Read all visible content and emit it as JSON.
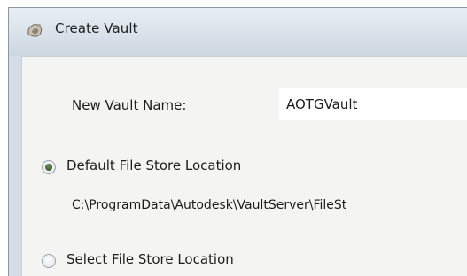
{
  "window": {
    "title": "Create Vault",
    "icon": "vault-app-icon"
  },
  "form": {
    "vault_name_label": "New Vault Name:",
    "vault_name_value": "AOTGVault",
    "file_store": {
      "default_option_label": "Default File Store Location",
      "default_option_selected": true,
      "default_path": "C:\\ProgramData\\Autodesk\\VaultServer\\FileSt",
      "select_option_label": "Select File Store Location",
      "select_option_selected": false
    }
  }
}
